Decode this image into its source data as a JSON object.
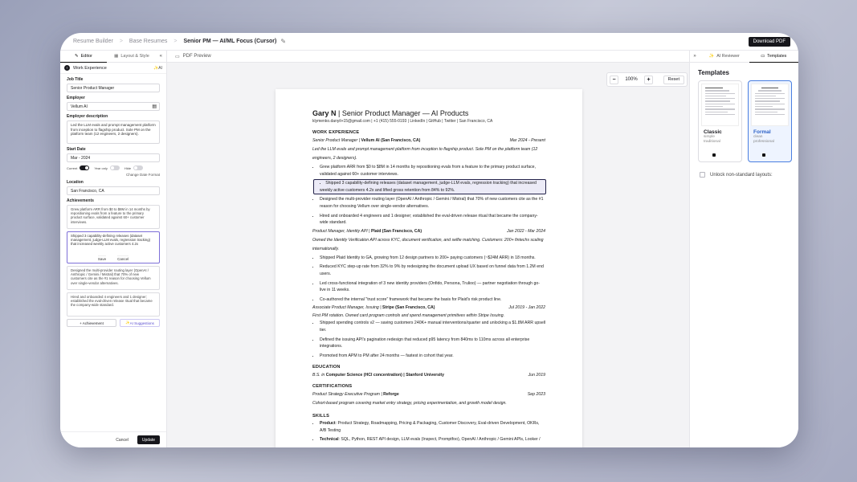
{
  "breadcrumb": {
    "root": "Resume Builder",
    "parent": "Base Resumes",
    "current": "Senior PM — AI/ML Focus (Cursor)"
  },
  "download_label": "Download PDF",
  "left": {
    "tabs": {
      "editor": "Editor",
      "layout": "Layout & Style"
    },
    "section": "Work Experience",
    "ai_label": "AI",
    "job_title_label": "Job Title",
    "job_title": "Senior Product Manager",
    "employer_label": "Employer",
    "employer": "Vellum AI",
    "employer_desc_label": "Employer description",
    "employer_desc": "Led the LLM evals and prompt management platform from inception to flagship product. Sole PM on the platform team (12 engineers, 2 designers).",
    "start_label": "Start Date",
    "start": "Mar - 2024",
    "toggles": {
      "current": "Current",
      "year_only": "Year only",
      "hide": "Hide"
    },
    "change_date_format": "Change Date Format",
    "location_label": "Location",
    "location": "San Francisco, CA",
    "achievements_label": "Achievements",
    "achievements": [
      "Grew platform ARR from $0 to $8M in 14 months by repositioning evals from a feature to the primary product surface, validated against 60+ customer interviews.",
      "Shipped 3 capability-defining releases (dataset management, judge-LLM evals, regression tracking) that increased weekly active customers 4.2x",
      "Designed the multi-provider routing layer (OpenAI / Anthropic / Gemini / Mistral) that 70% of new customers cite as the #1 reason for choosing Vellum over single-vendor alternatives.",
      "Hired and onboarded 4 engineers and 1 designer; established the eval-driven release ritual that became the company-wide standard."
    ],
    "save": "Save",
    "cancel_small": "Cancel",
    "add_achievement": "+ Achievement",
    "ai_suggestions": "AI Suggestions",
    "cancel": "Cancel",
    "update": "Update"
  },
  "center": {
    "tab": "PDF Preview",
    "zoom": "100%",
    "reset": "Reset"
  },
  "resume": {
    "name": "Gary N",
    "title": " | Senior Product Manager — AI Products",
    "contact": "klymenko.danyil+15@gmail.com | +1 (415) 555-0193 | LinkedIn | GitHub | Twitter | San Francisco, CA",
    "work_heading": "WORK EXPERIENCE",
    "jobs": [
      {
        "role": "Senior Product Manager | ",
        "employer": "Vellum AI (San Francisco, CA)",
        "dates": "Mar 2024 - Present",
        "desc": "Led the LLM evals and prompt management platform from inception to flagship product. Sole PM on the platform team (12 engineers, 2 designers).",
        "bullets": [
          "Grew platform ARR from $0 to $8M in 14 months by repositioning evals from a feature to the primary product surface, validated against 60+ customer interviews.",
          "Shipped 3 capability-defining releases (dataset management, judge-LLM evals, regression tracking) that increased weekly active customers 4.2x and lifted gross retention from 84% to 92%.",
          "Designed the multi-provider routing layer (OpenAI / Anthropic / Gemini / Mistral) that 70% of new customers cite as the #1 reason for choosing Vellum over single-vendor alternatives.",
          "Hired and onboarded 4 engineers and 1 designer; established the eval-driven release ritual that became the company-wide standard."
        ]
      },
      {
        "role": "Product Manager, Identity API | ",
        "employer": "Plaid (San Francisco, CA)",
        "dates": "Jan 2022 - Mar 2024",
        "desc": "Owned the Identity Verification API across KYC, document verification, and selfie matching. Customers: 200+ fintechs scaling internationally.",
        "bullets": [
          "Shipped Plaid Identity to GA, growing from 12 design partners to 200+ paying customers (~$24M ARR) in 18 months.",
          "Reduced KYC step-up rate from 32% to 9% by redesigning the document upload UX based on funnel data from 1.2M end users.",
          "Led cross-functional integration of 3 new identity providers (Onfido, Persona, Trulioo) — partner negotiation through go-live in 11 weeks.",
          "Co-authored the internal \"trust score\" framework that became the basis for Plaid's risk product line."
        ]
      },
      {
        "role": "Associate Product Manager, Issuing | ",
        "employer": "Stripe (San Francisco, CA)",
        "dates": "Jul 2019 - Jan 2022",
        "desc": "First PM rotation. Owned card program controls and spend management primitives within Stripe Issuing.",
        "bullets": [
          "Shipped spending controls v2 — saving customers 240K+ manual interventions/quarter and unlocking a $1.8M ARR upsell tier.",
          "Defined the issuing API's pagination redesign that reduced p95 latency from 840ms to 110ms across all enterprise integrations.",
          "Promoted from APM to PM after 24 months — fastest in cohort that year."
        ]
      }
    ],
    "education_heading": "EDUCATION",
    "education": {
      "degree": "B.S. in ",
      "field": "Computer Science (HCI concentration)",
      "school": " | Stanford University",
      "date": "Jun 2019"
    },
    "cert_heading": "CERTIFICATIONS",
    "cert": {
      "name": "Product Strategy Executive Program | ",
      "org": "Reforge",
      "date": "Sep 2023",
      "desc": "Cohort-based program covering market entry strategy, pricing experimentation, and growth model design."
    },
    "skills_heading": "SKILLS",
    "skills": [
      {
        "label": "Product",
        "value": ": Product Strategy, Roadmapping, Pricing & Packaging, Customer Discovery, Eval-driven Development, OKRs, A/B Testing"
      },
      {
        "label": "Technical",
        "value": ": SQL, Python, REST API design, LLM evals (Inspect, Promptfoo), OpenAI / Anthropic / Gemini APIs, Looker /"
      }
    ]
  },
  "right": {
    "tabs": {
      "reviewer": "AI Reviewer",
      "templates": "Templates"
    },
    "heading": "Templates",
    "templates": [
      {
        "name": "Classic",
        "tags": [
          "simple",
          "traditional"
        ]
      },
      {
        "name": "Formal",
        "tags": [
          "clean",
          "professional"
        ]
      }
    ],
    "unlock": "Unlock non-standard layouts:"
  }
}
